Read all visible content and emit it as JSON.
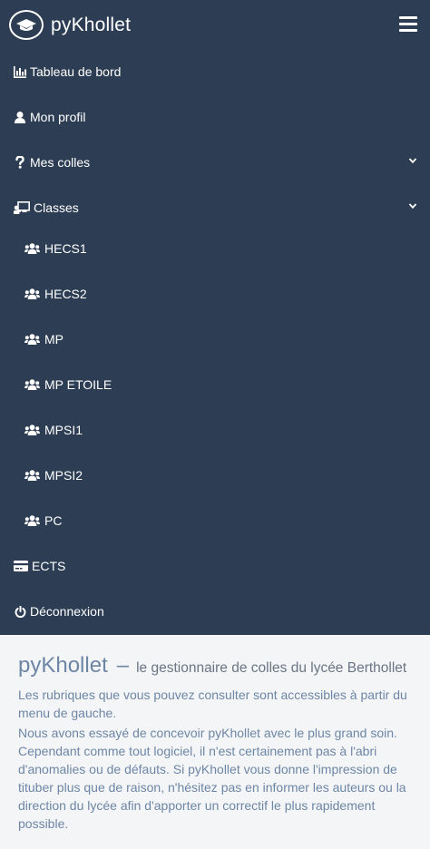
{
  "app": {
    "name": "pyKhollet",
    "logo_icon": "graduation-cap-icon",
    "menu_icon": "hamburger-icon"
  },
  "menu": {
    "items": [
      {
        "label": "Tableau de bord",
        "icon": "bar-chart-icon"
      },
      {
        "label": "Mon profil",
        "icon": "user-icon"
      },
      {
        "label": "Mes colles",
        "icon": "question-icon",
        "expandable": true
      },
      {
        "label": "Classes",
        "icon": "chalkboard-teacher-icon",
        "expandable": true
      }
    ],
    "classes": [
      {
        "label": "HECS1",
        "icon": "users-icon"
      },
      {
        "label": "HECS2",
        "icon": "users-icon"
      },
      {
        "label": "MP",
        "icon": "users-icon"
      },
      {
        "label": "MP ETOILE",
        "icon": "users-icon"
      },
      {
        "label": "MPSI1",
        "icon": "users-icon"
      },
      {
        "label": "MPSI2",
        "icon": "users-icon"
      },
      {
        "label": "PC",
        "icon": "users-icon"
      }
    ],
    "bottom": [
      {
        "label": "ECTS",
        "icon": "credit-card-icon"
      },
      {
        "label": "Déconnexion",
        "icon": "power-off-icon"
      }
    ]
  },
  "main": {
    "title": "pyKhollet",
    "dash": "–",
    "tagline": "le gestionnaire de colles du lycée Berthollet",
    "paragraph1": "Les rubriques que vous pouvez consulter sont accessibles à partir du menu de gauche.",
    "paragraph2": "Nous avons essayé de concevoir pyKhollet avec le plus grand soin. Cependant comme tout logiciel, il n'est certainement pas à l'abri d'anomalies ou de défauts. Si pyKhollet vous donne l'impression de tituber plus que de raison, n'hésitez pas en informer les auteurs ou la direction du lycée afin d'apporter un correctif le plus rapidement possible."
  },
  "colors": {
    "nav_bg": "#2d3e54",
    "page_bg": "#f4f5f7",
    "text_accent": "#6d86a6"
  }
}
